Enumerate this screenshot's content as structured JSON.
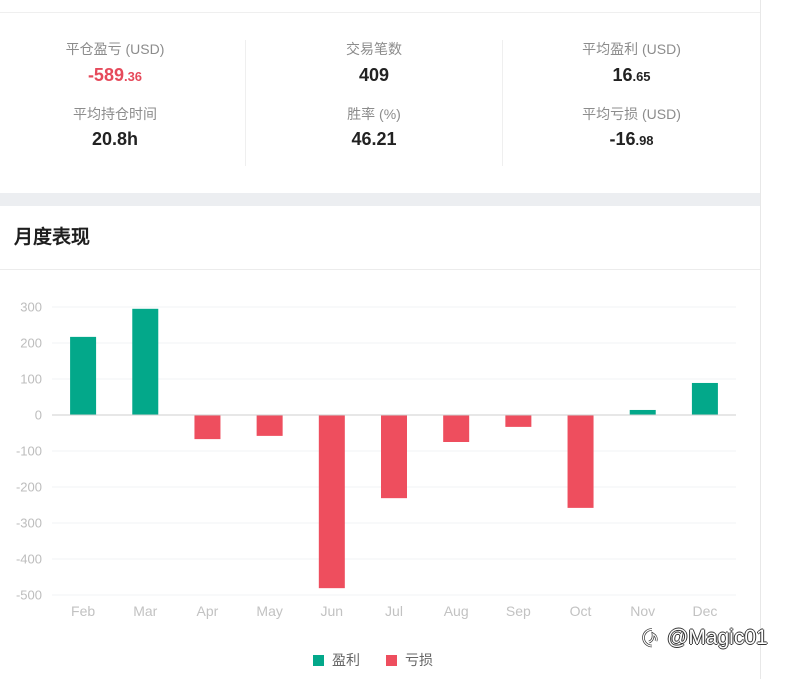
{
  "summary": {
    "realized_pnl": {
      "label": "平仓盈亏 (USD)",
      "value_main": "-589",
      "value_decimal": ".36"
    },
    "avg_holding_time": {
      "label": "平均持仓时间",
      "value": "20.8h"
    },
    "trade_count": {
      "label": "交易笔数",
      "value": "409"
    },
    "win_rate": {
      "label": "胜率 (%)",
      "value": "46.21"
    },
    "avg_profit": {
      "label": "平均盈利 (USD)",
      "value_main": "16",
      "value_decimal": ".65"
    },
    "avg_loss": {
      "label": "平均亏损 (USD)",
      "value_main": "-16",
      "value_decimal": ".98"
    }
  },
  "colors": {
    "profit": "#03A88A",
    "loss": "#EE4E5E",
    "negative_text": "#E64A5B"
  },
  "chart_data": {
    "type": "bar",
    "title": "月度表现",
    "categories": [
      "Feb",
      "Mar",
      "Apr",
      "May",
      "Jun",
      "Jul",
      "Aug",
      "Sep",
      "Oct",
      "Nov",
      "Dec"
    ],
    "values": [
      217,
      295,
      -67,
      -58,
      -481,
      -231,
      -75,
      -33,
      -258,
      14,
      89
    ],
    "ylim": [
      -500,
      300
    ],
    "yticks": [
      300,
      200,
      100,
      0,
      -100,
      -200,
      -300,
      -400,
      -500
    ],
    "grid": true,
    "legend": {
      "placement": "bottom-center",
      "entries": [
        {
          "label": "盈利",
          "color": "#03A88A"
        },
        {
          "label": "亏损",
          "color": "#EE4E5E"
        }
      ]
    }
  },
  "watermark": {
    "text": "@Magic01",
    "icon": "weibo-logo-icon"
  }
}
